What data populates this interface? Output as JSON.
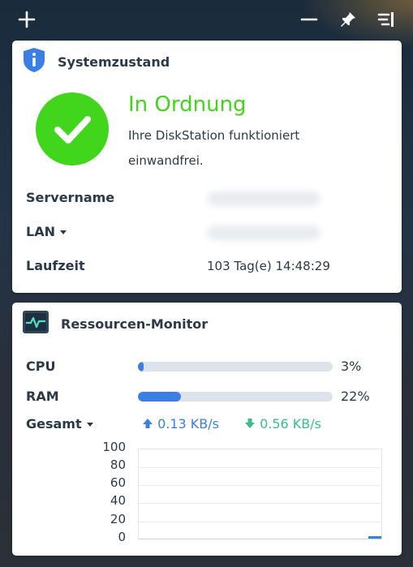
{
  "toolbar": {
    "add_icon": "plus-icon",
    "minimize_icon": "minus-icon",
    "pin_icon": "pin-icon",
    "panel_icon": "dock-right-icon"
  },
  "health": {
    "title": "Systemzustand",
    "icon": "info-shield-icon",
    "status_title": "In Ordnung",
    "status_desc": "Ihre DiskStation funktioniert einwandfrei.",
    "status_color": "#41d61c",
    "rows": {
      "servername_label": "Servername",
      "lan_label": "LAN",
      "uptime_label": "Laufzeit",
      "uptime_value": "103 Tag(e) 14:48:29"
    }
  },
  "resources": {
    "title": "Ressourcen-Monitor",
    "icon": "monitor-pulse-icon",
    "cpu_label": "CPU",
    "cpu_percent": 3,
    "cpu_text": "3%",
    "ram_label": "RAM",
    "ram_percent": 22,
    "ram_text": "22%",
    "network_label": "Gesamt",
    "upload": "0.13 KB/s",
    "download": "0.56 KB/s",
    "accent": "#3a7fe6",
    "download_color": "#37c08c",
    "chart_yticks": [
      "100",
      "80",
      "60",
      "40",
      "20",
      "0"
    ]
  }
}
